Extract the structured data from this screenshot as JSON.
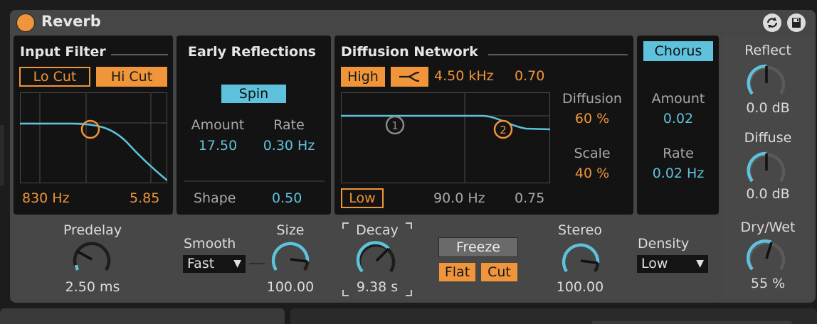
{
  "device": {
    "title": "Reverb",
    "colors": {
      "accent_orange": "#f0953a",
      "accent_blue": "#5fc2dc",
      "panel": "#131313",
      "device_bg": "#464646"
    },
    "header_icons": [
      "hot-swap-icon",
      "save-preset-icon"
    ]
  },
  "input_filter": {
    "title": "Input Filter",
    "lo_cut": "Lo Cut",
    "hi_cut": "Hi Cut",
    "freq": "830 Hz",
    "width": "5.85"
  },
  "early_reflections": {
    "title": "Early Reflections",
    "spin": "Spin",
    "amount_label": "Amount",
    "amount_value": "17.50",
    "rate_label": "Rate",
    "rate_value": "0.30 Hz",
    "shape_label": "Shape",
    "shape_value": "0.50"
  },
  "diffusion_network": {
    "title": "Diffusion Network",
    "high": "High",
    "high_freq": "4.50 kHz",
    "high_value": "0.70",
    "low": "Low",
    "low_freq": "90.0 Hz",
    "low_value": "0.75",
    "diffusion_label": "Diffusion",
    "diffusion_value": "60 %",
    "scale_label": "Scale",
    "scale_value": "40 %",
    "point_1": "1",
    "point_2": "2"
  },
  "chorus": {
    "button": "Chorus",
    "amount_label": "Amount",
    "amount_value": "0.02",
    "rate_label": "Rate",
    "rate_value": "0.02 Hz"
  },
  "right": {
    "reflect_label": "Reflect",
    "reflect_value": "0.0 dB",
    "diffuse_label": "Diffuse",
    "diffuse_value": "0.0 dB",
    "drywet_label": "Dry/Wet",
    "drywet_value": "55 %"
  },
  "bottom": {
    "predelay_label": "Predelay",
    "predelay_value": "2.50 ms",
    "smooth_label": "Smooth",
    "smooth_value": "Fast",
    "size_label": "Size",
    "size_value": "100.00",
    "decay_label": "Decay",
    "decay_value": "9.38 s",
    "freeze": "Freeze",
    "flat": "Flat",
    "cut": "Cut",
    "stereo_label": "Stereo",
    "stereo_value": "100.00",
    "density_label": "Density",
    "density_value": "Low"
  }
}
